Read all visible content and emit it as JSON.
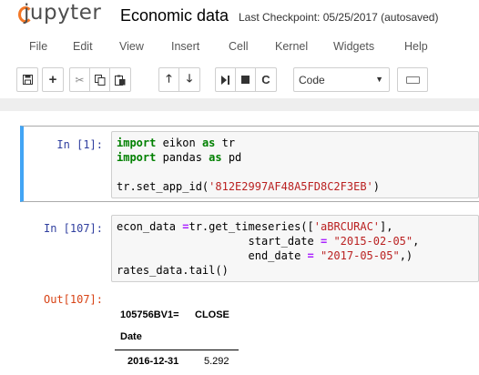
{
  "header": {
    "logo_text": "jupyter",
    "notebook_name": "Economic data",
    "checkpoint": "Last Checkpoint: 05/25/2017 (autosaved)"
  },
  "menu": [
    "File",
    "Edit",
    "View",
    "Insert",
    "Cell",
    "Kernel",
    "Widgets",
    "Help"
  ],
  "toolbar": {
    "cell_type": "Code",
    "buttons": [
      "save-icon",
      "add-icon",
      "cut-icon",
      "copy-icon",
      "paste-icon",
      "move-up-icon",
      "move-down-icon",
      "run-icon",
      "stop-icon",
      "restart-icon",
      "keyboard-icon"
    ]
  },
  "cells": [
    {
      "prompt": "In [1]:",
      "lines": [
        "import eikon as tr",
        "import pandas as pd",
        "",
        "tr.set_app_id('812E2997AF48A5FD8C2F3EB')"
      ]
    },
    {
      "prompt": "In [107]:",
      "lines": [
        "econ_data =tr.get_timeseries(['aBRCURAC'],",
        "                    start_date = \"2015-02-05\",",
        "                    end_date = \"2017-05-05\",)",
        "rates_data.tail()"
      ]
    }
  ],
  "output": {
    "prompt": "Out[107]:",
    "columns": [
      "105756BV1=",
      "CLOSE"
    ],
    "index_name": "Date",
    "rows": [
      {
        "date": "2016-12-31",
        "value": "5.292"
      }
    ]
  },
  "colors": {
    "logo_orange": "#f37726",
    "prompt_in": "#303f9f",
    "prompt_out": "#d84315",
    "selected_border": "#42a5f5"
  }
}
